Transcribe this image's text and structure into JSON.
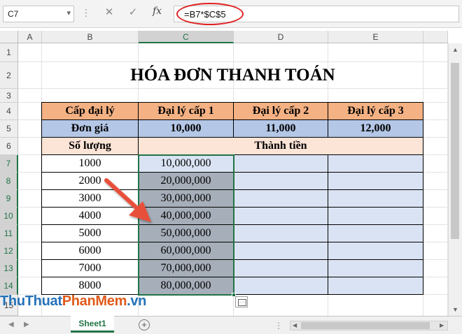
{
  "formula_bar": {
    "name_box": "C7",
    "formula": "=B7*$C$5",
    "fx_label": "fx"
  },
  "columns": [
    "A",
    "B",
    "C",
    "D",
    "E"
  ],
  "rows": [
    "1",
    "2",
    "3",
    "4",
    "5",
    "6",
    "7",
    "8",
    "9",
    "10",
    "11",
    "12",
    "13",
    "14",
    "15"
  ],
  "sheet": {
    "title": "HÓA ĐƠN THANH TOÁN",
    "header_row": {
      "col_b": "Cấp đại lý",
      "col_c": "Đại lý cấp 1",
      "col_d": "Đại lý cấp 2",
      "col_e": "Đại lý cấp 3"
    },
    "price_row": {
      "label": "Đơn giá",
      "c": "10,000",
      "d": "11,000",
      "e": "12,000"
    },
    "qty_row": {
      "label": "Số lượng",
      "merged": "Thành tiền"
    },
    "data_rows": [
      {
        "qty": "1000",
        "c": "10,000,000"
      },
      {
        "qty": "2000",
        "c": "20,000,000"
      },
      {
        "qty": "3000",
        "c": "30,000,000"
      },
      {
        "qty": "4000",
        "c": "40,000,000"
      },
      {
        "qty": "5000",
        "c": "50,000,000"
      },
      {
        "qty": "6000",
        "c": "60,000,000"
      },
      {
        "qty": "7000",
        "c": "70,000,000"
      },
      {
        "qty": "8000",
        "c": "80,000,000"
      }
    ]
  },
  "tabs": {
    "active": "Sheet1"
  },
  "watermark": {
    "part1": "ThuThuat",
    "part2": "PhanMem",
    "part3": ".vn"
  },
  "colors": {
    "header_fill": "#f4b183",
    "price_fill": "#b4c7e7",
    "qty_fill": "#fce4d6",
    "data_fill": "#dae3f3",
    "selected_fill": "#a6aeb9",
    "accent": "#217346",
    "annotation": "#e02020"
  },
  "icons": [
    "dropdown-icon",
    "cancel-icon",
    "enter-icon",
    "function-icon",
    "arrow-annotation-icon",
    "quick-analysis-icon",
    "add-sheet-icon"
  ]
}
